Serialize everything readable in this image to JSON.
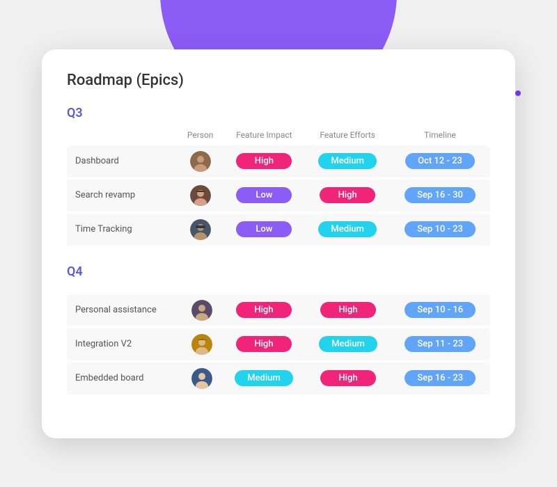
{
  "page": {
    "title": "Roadmap (Epics)"
  },
  "decorations": {
    "slash_color": "#1a1a2e",
    "dot_color": "#7C3AED"
  },
  "q3": {
    "label": "Q3",
    "headers": {
      "feature": "",
      "person": "Person",
      "impact": "Feature Impact",
      "efforts": "Feature Efforts",
      "timeline": "Timeline"
    },
    "rows": [
      {
        "name": "Dashboard",
        "person_avatar": "person1",
        "impact": "High",
        "impact_class": "badge-high-pink",
        "efforts": "Medium",
        "efforts_class": "badge-medium-cyan",
        "timeline": "Oct 12 - 23",
        "timeline_class": "badge-timeline"
      },
      {
        "name": "Search revamp",
        "person_avatar": "person2",
        "impact": "Low",
        "impact_class": "badge-low-purple",
        "efforts": "High",
        "efforts_class": "badge-high-pink",
        "timeline": "Sep 16 - 30",
        "timeline_class": "badge-timeline"
      },
      {
        "name": "Time Tracking",
        "person_avatar": "person3",
        "impact": "Low",
        "impact_class": "badge-low-purple",
        "efforts": "Medium",
        "efforts_class": "badge-medium-cyan",
        "timeline": "Sep 10 - 23",
        "timeline_class": "badge-timeline"
      }
    ]
  },
  "q4": {
    "label": "Q4",
    "rows": [
      {
        "name": "Personal assistance",
        "person_avatar": "person4",
        "impact": "High",
        "impact_class": "badge-high-pink",
        "efforts": "High",
        "efforts_class": "badge-high-pink",
        "timeline": "Sep 10 - 16",
        "timeline_class": "badge-timeline"
      },
      {
        "name": "Integration V2",
        "person_avatar": "person5",
        "impact": "High",
        "impact_class": "badge-high-pink",
        "efforts": "Medium",
        "efforts_class": "badge-medium-cyan",
        "timeline": "Sep 11 - 23",
        "timeline_class": "badge-timeline"
      },
      {
        "name": "Embedded board",
        "person_avatar": "person6",
        "impact": "Medium",
        "impact_class": "badge-medium-cyan",
        "efforts": "High",
        "efforts_class": "badge-high-pink",
        "timeline": "Sep 16 - 23",
        "timeline_class": "badge-timeline"
      }
    ]
  }
}
